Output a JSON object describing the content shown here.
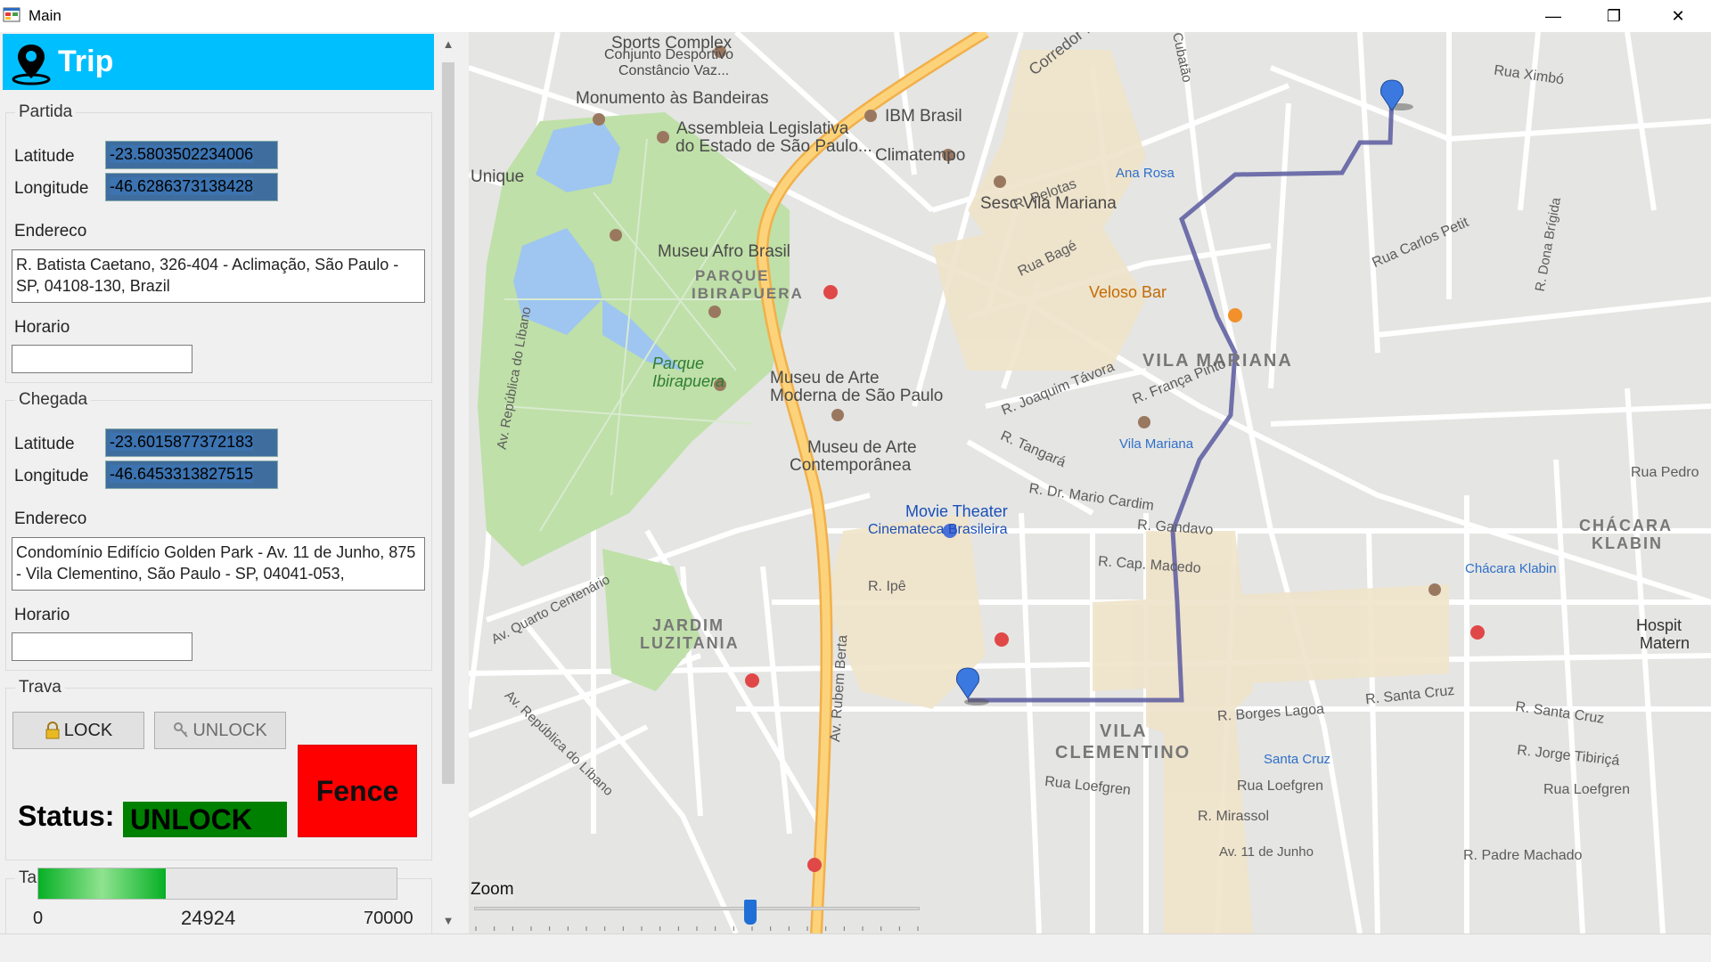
{
  "window": {
    "title": "Main",
    "minimize": "—",
    "maximize": "❐",
    "close": "✕"
  },
  "header": {
    "title": "Trip"
  },
  "partida": {
    "legend": "Partida",
    "latitude_label": "Latitude",
    "latitude": "-23.5803502234006",
    "longitude_label": "Longitude",
    "longitude": "-46.6286373138428",
    "endereco_label": "Endereco",
    "endereco": "R. Batista Caetano, 326-404 - Aclimação, São Paulo - SP, 04108-130, Brazil",
    "horario_label": "Horario",
    "horario": ""
  },
  "chegada": {
    "legend": "Chegada",
    "latitude_label": "Latitude",
    "latitude": "-23.6015877372183",
    "longitude_label": "Longitude",
    "longitude": "-46.6453313827515",
    "endereco_label": "Endereco",
    "endereco": "Condomínio Edifício Golden Park - Av. 11 de Junho, 875 - Vila Clementino, São Paulo - SP, 04041-053,",
    "horario_label": "Horario",
    "horario": ""
  },
  "trava": {
    "legend": "Trava",
    "lock_label": "LOCK",
    "unlock_label": "UNLOCK",
    "fence_label": "Fence",
    "status_label": "Status:",
    "status_value": "UNLOCK",
    "status_color": "#008000",
    "fence_color": "#ff0000"
  },
  "tanque": {
    "legend": "Tanque Nivel",
    "min": "0",
    "value": "24924",
    "max": "70000",
    "fill_fraction": 0.356
  },
  "map": {
    "zoom_label": "Zoom",
    "zoom_fraction": 0.62,
    "labels": {
      "sports": "Sports Complex",
      "sports2": "Conjunto Desportivo",
      "sports3": "Constâncio Vaz...",
      "corredor": "Corredor Nor",
      "cubatao": "Cubatão",
      "monumento": "Monumento às Bandeiras",
      "ibm": "IBM Brasil",
      "assembleia": "Assembleia Legislativa",
      "assembleia2": "do Estado de São Paulo...",
      "climatempo": "Climatempo",
      "unique": "Unique",
      "sesc": "Sesc Vila Mariana",
      "ana_rosa": "Ana Rosa",
      "afro": "Museu Afro Brasil",
      "parque_ibira": "PARQUE",
      "parque_ibira2": "IBIRAPUERA",
      "parque": "Parque",
      "parque2": "Ibirapuera",
      "mam": "Museu de Arte",
      "mam2": "Moderna de São Paulo",
      "mac": "Museu de Arte",
      "mac2": "Contemporânea",
      "veloso": "Veloso Bar",
      "vila_mariana": "VILA MARIANA",
      "vila_mariana_m": "Vila Mariana",
      "movie": "Movie Theater",
      "cinemateca": "Cinemateca Brasileira",
      "chacara": "CHÁCARA",
      "chacara2": "KLABIN",
      "chacara_m": "Chácara Klabin",
      "jardim": "JARDIM",
      "jardim2": "LUZITANIA",
      "vila_clem": "VILA",
      "vila_clem2": "CLEMENTINO",
      "santa_cruz": "Santa Cruz",
      "hospital": "Hospit",
      "hospital2": "Matern",
      "r_pelotas": "R. Pelotas",
      "rua_bage": "Rua Bagé",
      "rua_ximbo": "Rua Ximbó",
      "rua_carlos": "Rua Carlos Petit",
      "r_dona": "R. Dona Brígida",
      "r_joaquim": "R. Joaquim Távora",
      "r_franca": "R. França Pinto",
      "r_tangara": "R. Tangará",
      "r_mario": "R. Dr. Mario Cardim",
      "r_gandavo": "R. Gandavo",
      "r_macedo": "R. Cap. Macedo",
      "r_ipe": "R. Ipê",
      "rubem": "Av. Rubem Berta",
      "santa_cruz_r": "R. Santa Cruz",
      "santa_cruz_r2": "R. Santa Cruz",
      "borges": "R. Borges Lagoa",
      "tibirica": "R. Jorge Tibiriçá",
      "loefgren": "Rua Loefgren",
      "loefgren2": "Rua Loefgren",
      "loefgren3": "Rua Loefgren",
      "mirassol": "R. Mirassol",
      "junho": "Av. 11 de Junho",
      "padre": "R. Padre Machado",
      "rua_pedro": "Rua Pedro",
      "quarto": "Av. Quarto Centenário",
      "republica": "Av. República do Líbano",
      "republica2": "Av. República do Líbano"
    }
  }
}
